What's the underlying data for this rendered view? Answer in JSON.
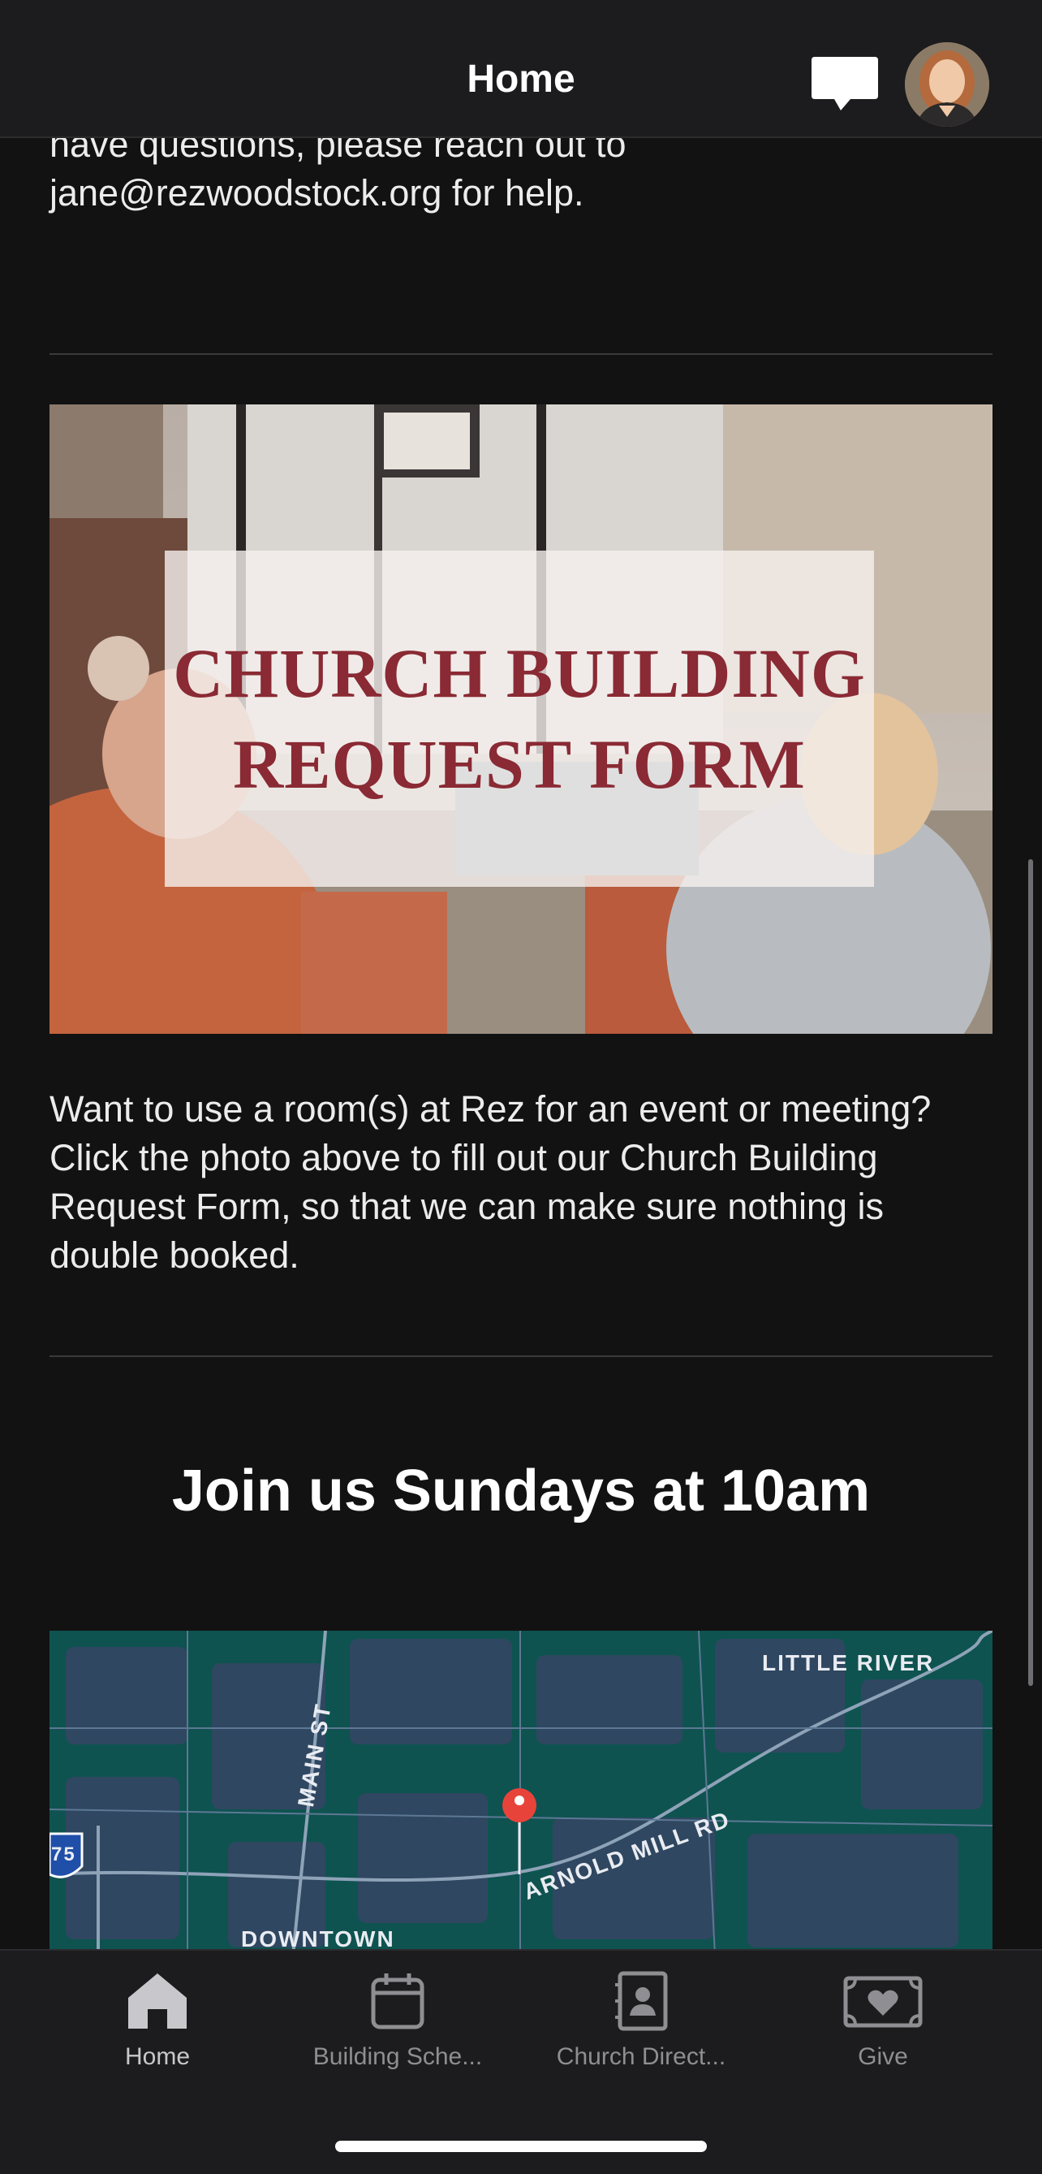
{
  "header": {
    "title": "Home",
    "chat_icon": "chat-bubble-icon",
    "avatar_icon": "profile-avatar"
  },
  "content": {
    "intro_text": "have questions, please reach out to jane@rezwoodstock.org for help.",
    "banner": {
      "line1": "CHURCH BUILDING",
      "line2": "REQUEST FORM"
    },
    "request_text": "Want to use a room(s) at Rez for an event or meeting? Click the photo above to fill out our Church Building Request Form, so that we can make sure nothing is double booked.",
    "section_heading": "Join us Sundays at 10am",
    "map": {
      "labels": {
        "little_river": "LITTLE RIVER",
        "main_st": "MAIN ST",
        "arnold_mill": "ARNOLD MILL RD",
        "downtown": "DOWNTOWN",
        "interstate": "75"
      }
    }
  },
  "tabs": [
    {
      "label": "Home",
      "icon": "home-icon",
      "active": true
    },
    {
      "label": "Building Sche...",
      "icon": "calendar-icon",
      "active": false
    },
    {
      "label": "Church Direct...",
      "icon": "contact-book-icon",
      "active": false
    },
    {
      "label": "Give",
      "icon": "heart-money-icon",
      "active": false
    }
  ],
  "colors": {
    "background": "#121212",
    "bar_background": "#1c1c1e",
    "banner_text": "#8a2a34",
    "map_green": "#0e5350",
    "map_pin": "#e8433a"
  }
}
